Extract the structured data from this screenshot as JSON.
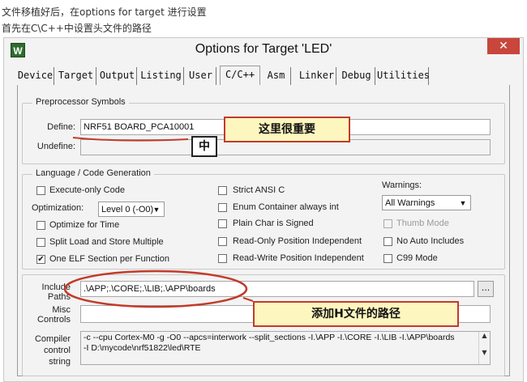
{
  "intro": {
    "line1": "文件移植好后，在options for target 进行设置",
    "line2": "首先在C\\C++中设置头文件的路径"
  },
  "dialog": {
    "app_icon": "W",
    "title": "Options for Target 'LED'",
    "close_glyph": "✕"
  },
  "tabs": [
    {
      "label": "Device",
      "active": false
    },
    {
      "label": "Target",
      "active": false
    },
    {
      "label": "Output",
      "active": false
    },
    {
      "label": "Listing",
      "active": false
    },
    {
      "label": "User",
      "active": false
    },
    {
      "label": "C/C++",
      "active": true
    },
    {
      "label": "Asm",
      "active": false
    },
    {
      "label": "Linker",
      "active": false
    },
    {
      "label": "Debug",
      "active": false
    },
    {
      "label": "Utilities",
      "active": false
    }
  ],
  "preprocessor": {
    "group_label": "Preprocessor Symbols",
    "define_label": "Define:",
    "define_value": "NRF51 BOARD_PCA10001",
    "undefine_label": "Undefine:",
    "undefine_value": ""
  },
  "language": {
    "group_label": "Language / Code Generation",
    "execute_only": {
      "label": "Execute-only Code",
      "checked": false
    },
    "optimization_label": "Optimization:",
    "optimization_value": "Level 0 (-O0)",
    "optimize_time": {
      "label": "Optimize for Time",
      "checked": false
    },
    "split_load": {
      "label": "Split Load and Store Multiple",
      "checked": false
    },
    "one_elf": {
      "label": "One ELF Section per Function",
      "checked": true
    },
    "strict_ansi": {
      "label": "Strict ANSI C",
      "checked": false
    },
    "enum_container": {
      "label": "Enum Container always int",
      "checked": false
    },
    "plain_char": {
      "label": "Plain Char is Signed",
      "checked": false
    },
    "ro_pi": {
      "label": "Read-Only Position Independent",
      "checked": false
    },
    "rw_pi": {
      "label": "Read-Write Position Independent",
      "checked": false
    },
    "warnings_label": "Warnings:",
    "warnings_value": "All Warnings",
    "thumb_mode": {
      "label": "Thumb Mode",
      "checked": false,
      "disabled": true
    },
    "no_auto_includes": {
      "label": "No Auto Includes",
      "checked": false
    },
    "c99": {
      "label": "C99 Mode",
      "checked": false
    },
    "check_glyph": "✔"
  },
  "paths": {
    "include_label_1": "Include",
    "include_label_2": "Paths",
    "include_value": ".\\APP;.\\CORE;.\\LIB;.\\APP\\boards",
    "browse_label": "...",
    "misc_label_1": "Misc",
    "misc_label_2": "Controls",
    "misc_value": "",
    "compiler_label_1": "Compiler",
    "compiler_label_2": "control",
    "compiler_label_3": "string",
    "compiler_line_1": "-c --cpu Cortex-M0 -g -O0 --apcs=interwork --split_sections -I.\\APP -I.\\CORE -I.\\LIB -I.\\APP\\boards",
    "compiler_line_2": "-I D:\\mycode\\nrf51822\\led\\RTE",
    "scroll_up": "▲",
    "scroll_down": "▼"
  },
  "annotations": {
    "callout_important": "这里很重要",
    "callout_zhong": "中",
    "callout_add_path": "添加H文件的路径",
    "highlight_color": "#c23b2a",
    "callout_fill": "#fdf6bf"
  },
  "combo_arrow": "▼"
}
